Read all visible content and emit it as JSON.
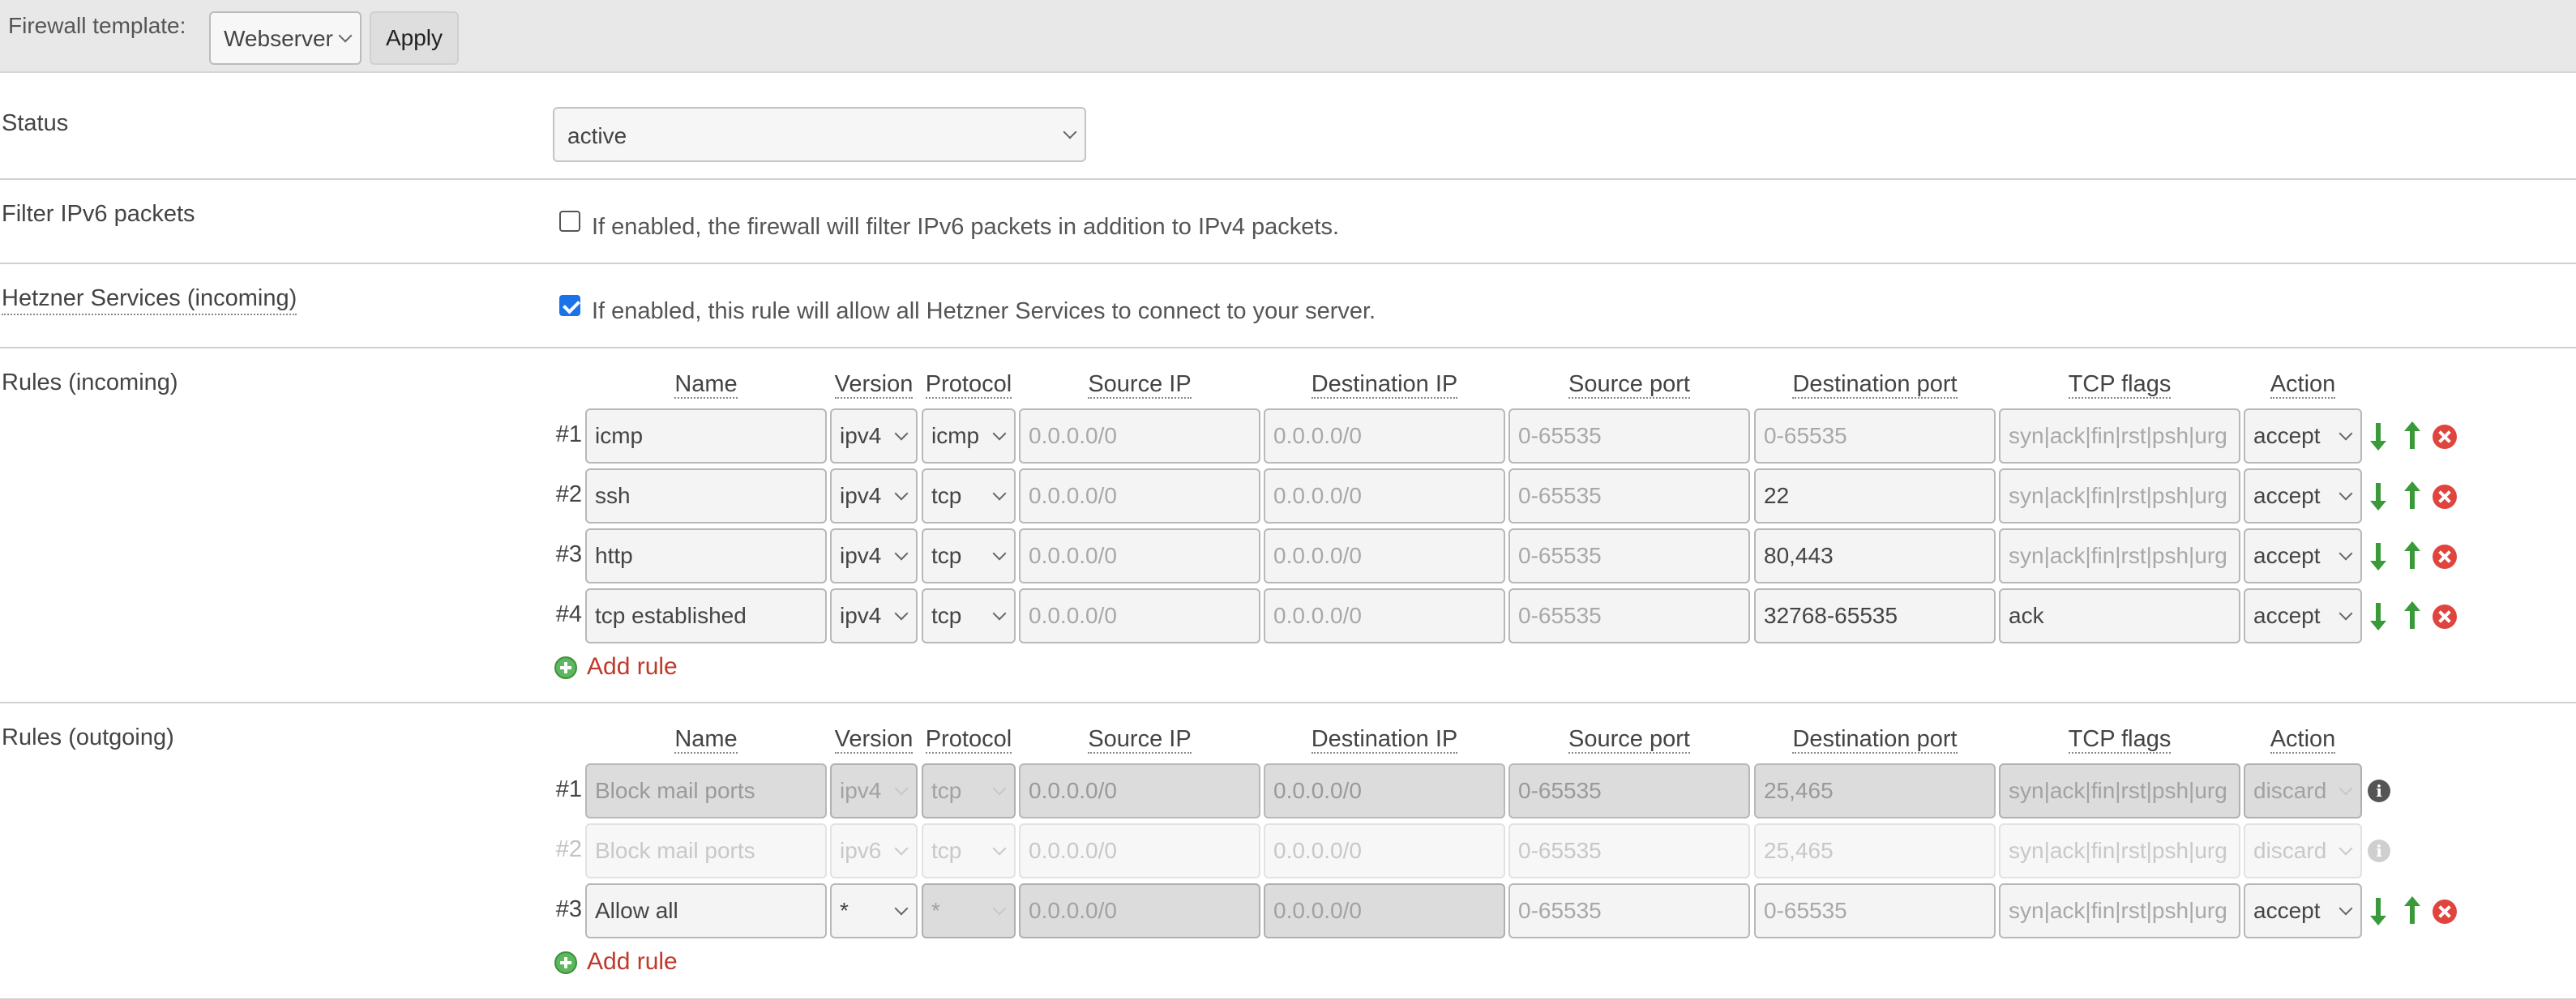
{
  "template": {
    "label": "Firewall template:",
    "selected": "Webserver",
    "apply_label": "Apply"
  },
  "status": {
    "label": "Status",
    "value": "active"
  },
  "ipv6": {
    "label": "Filter IPv6 packets",
    "checked": false,
    "description": "If enabled, the firewall will filter IPv6 packets in addition to IPv4 packets."
  },
  "hetzner": {
    "label": "Hetzner Services (incoming)",
    "checked": true,
    "description": "If enabled, this rule will allow all Hetzner Services to connect to your server."
  },
  "columns": [
    "Name",
    "Version",
    "Protocol",
    "Source IP",
    "Destination IP",
    "Source port",
    "Destination port",
    "TCP flags",
    "Action"
  ],
  "placeholders": {
    "source_ip": "0.0.0.0/0",
    "dest_ip": "0.0.0.0/0",
    "port": "0-65535",
    "tcp_flags": "syn|ack|fin|rst|psh|urg"
  },
  "incoming": {
    "label": "Rules (incoming)",
    "add_label": "Add rule",
    "rules": [
      {
        "num": "#1",
        "name": "icmp",
        "version": "ipv4",
        "protocol": "icmp",
        "src_ip": "",
        "dst_ip": "",
        "src_port": "",
        "dst_port": "",
        "tcp_flags": "",
        "action": "accept"
      },
      {
        "num": "#2",
        "name": "ssh",
        "version": "ipv4",
        "protocol": "tcp",
        "src_ip": "",
        "dst_ip": "",
        "src_port": "",
        "dst_port": "22",
        "tcp_flags": "",
        "action": "accept"
      },
      {
        "num": "#3",
        "name": "http",
        "version": "ipv4",
        "protocol": "tcp",
        "src_ip": "",
        "dst_ip": "",
        "src_port": "",
        "dst_port": "80,443",
        "tcp_flags": "",
        "action": "accept"
      },
      {
        "num": "#4",
        "name": "tcp established",
        "version": "ipv4",
        "protocol": "tcp",
        "src_ip": "",
        "dst_ip": "",
        "src_port": "",
        "dst_port": "32768-65535",
        "tcp_flags": "ack",
        "action": "accept"
      }
    ]
  },
  "outgoing": {
    "label": "Rules (outgoing)",
    "add_label": "Add rule",
    "rules": [
      {
        "num": "#1",
        "name": "Block mail ports",
        "version": "ipv4",
        "protocol": "tcp",
        "src_ip": "0.0.0.0/0",
        "dst_ip": "0.0.0.0/0",
        "src_port": "0-65535",
        "dst_port": "25,465",
        "tcp_flags": "syn|ack|fin|rst|psh|urg",
        "action": "discard",
        "state": "locked"
      },
      {
        "num": "#2",
        "name": "Block mail ports",
        "version": "ipv6",
        "protocol": "tcp",
        "src_ip": "0.0.0.0/0",
        "dst_ip": "0.0.0.0/0",
        "src_port": "0-65535",
        "dst_port": "25,465",
        "tcp_flags": "syn|ack|fin|rst|psh|urg",
        "action": "discard",
        "state": "faded"
      },
      {
        "num": "#3",
        "name": "Allow all",
        "version": "*",
        "protocol": "*",
        "src_ip": "0.0.0.0/0",
        "dst_ip": "0.0.0.0/0",
        "src_port": "",
        "dst_port": "",
        "tcp_flags": "",
        "action": "accept",
        "state": "editable"
      }
    ]
  },
  "colors": {
    "accent": "#1a73e8",
    "delete": "#e0443e",
    "add": "#5cb85c",
    "link": "#c0392b",
    "arrow": "#3a9a3a"
  },
  "icons": {
    "move_down": "arrow-down-icon",
    "move_up": "arrow-up-icon",
    "delete": "delete-icon",
    "info": "info-icon",
    "add": "plus-icon"
  }
}
